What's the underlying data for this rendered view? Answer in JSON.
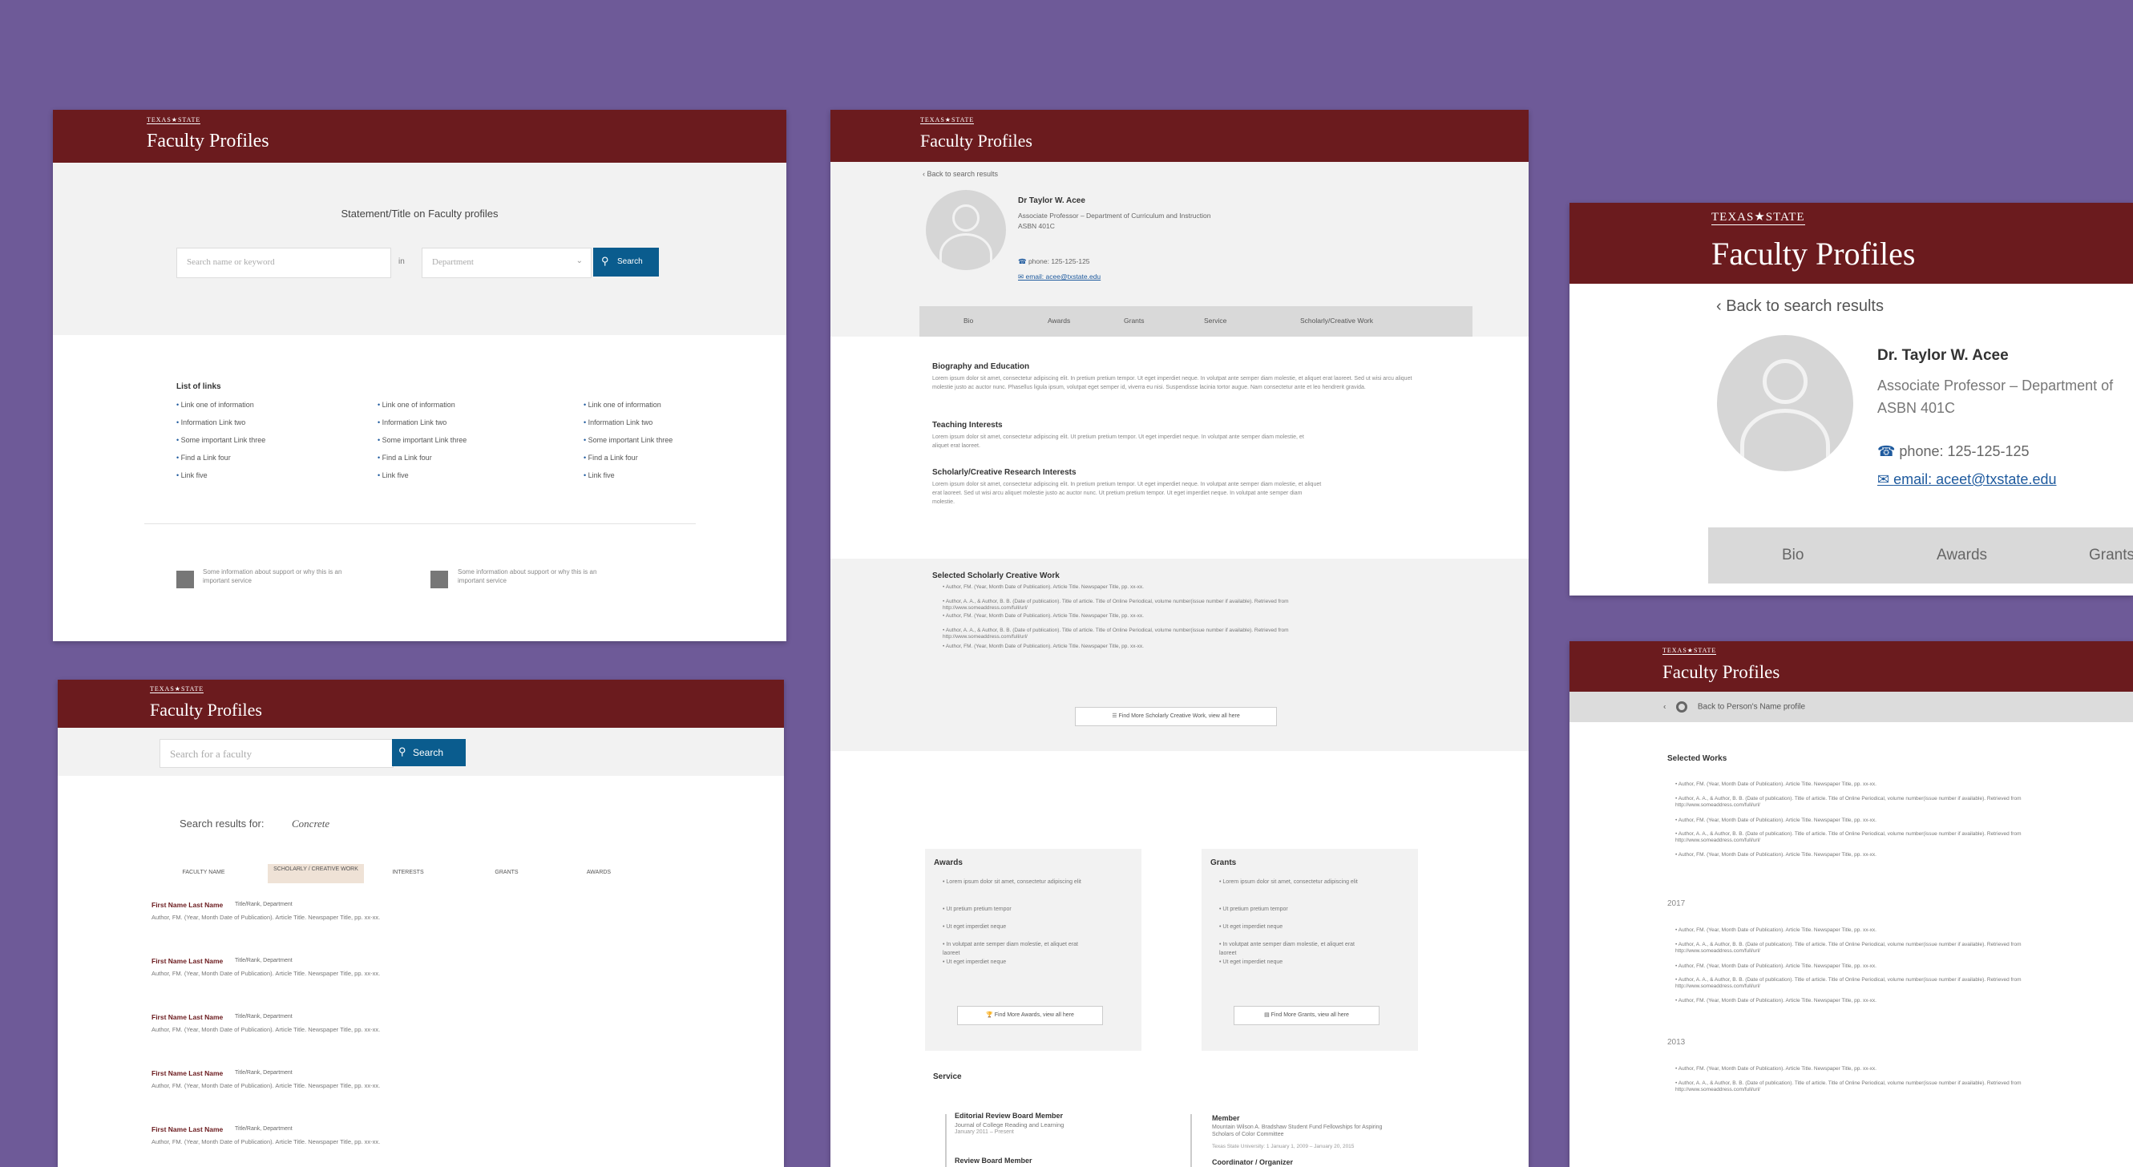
{
  "brand_text": "TEXAS★STATE",
  "app_title": "Faculty Profiles",
  "colors": {
    "header": "#6b1b1e",
    "background": "#6e5a98",
    "accent": "#0a5c8e",
    "link": "#1e5a9e"
  },
  "home": {
    "statement": "Statement/Title on Faculty profiles",
    "search_placeholder": "Search name or keyword",
    "in_label": "in",
    "dept_placeholder": "Department",
    "search_button": "Search",
    "links_title": "List of links",
    "links_col1": [
      "Link one of information",
      "Information Link two",
      "Some important Link three",
      "Find a Link four",
      "Link five"
    ],
    "links_col2": [
      "Link one of information",
      "Information Link two",
      "Some important Link three",
      "Find a Link four",
      "Link five"
    ],
    "links_col3": [
      "Link one of information",
      "Information Link two",
      "Some important Link three",
      "Find a Link four",
      "Link five"
    ],
    "support1": "Some information about support or why this is an important service",
    "support2": "Some information about support or why this is an important service"
  },
  "results": {
    "search_placeholder": "Search for a faculty",
    "search_button": "Search",
    "results_label": "Search results for:",
    "query": "Concrete",
    "tabs": [
      "FACULTY NAME",
      "SCHOLARLY / CREATIVE WORK",
      "INTERESTS",
      "GRANTS",
      "AWARDS"
    ],
    "items": [
      {
        "name": "First Name Last Name",
        "meta": "Title/Rank, Department",
        "citation": "Author, FM. (Year, Month Date of Publication). Article Title. Newspaper Title, pp. xx-xx."
      },
      {
        "name": "First Name Last Name",
        "meta": "Title/Rank, Department",
        "citation": "Author, FM. (Year, Month Date of Publication). Article Title. Newspaper Title, pp. xx-xx."
      },
      {
        "name": "First Name Last Name",
        "meta": "Title/Rank, Department",
        "citation": "Author, FM. (Year, Month Date of Publication). Article Title. Newspaper Title, pp. xx-xx."
      },
      {
        "name": "First Name Last Name",
        "meta": "Title/Rank, Department",
        "citation": "Author, FM. (Year, Month Date of Publication). Article Title. Newspaper Title, pp. xx-xx."
      },
      {
        "name": "First Name Last Name",
        "meta": "Title/Rank, Department",
        "citation": "Author, FM. (Year, Month Date of Publication). Article Title. Newspaper Title, pp. xx-xx."
      }
    ]
  },
  "profile": {
    "back": "Back to search results",
    "name": "Dr Taylor W. Acee",
    "position": "Associate Professor – Department of Curriculum and Instruction",
    "office": "ASBN 401C",
    "phone": "phone: 125-125-125",
    "email": "email: acee@txstate.edu",
    "tabs": [
      "Bio",
      "Awards",
      "Grants",
      "Service",
      "Scholarly/Creative Work"
    ],
    "bio_title": "Biography and Education",
    "bio_text": "Lorem ipsum dolor sit amet, consectetur adipiscing elit. In pretium pretium tempor. Ut eget imperdiet neque. In volutpat ante semper diam molestie, et aliquet erat laoreet. Sed ut wisi arcu aliquet molestie justo ac auctor nunc. Phasellus ligula ipsum, volutpat eget semper id, viverra eu nisi. Suspendisse lacinia tortor augue. Nam consectetur ante et leo hendrerit gravida.",
    "teach_title": "Teaching Interests",
    "teach_text": "Lorem ipsum dolor sit amet, consectetur adipiscing elit. Ut pretium pretium tempor. Ut eget imperdiet neque. In volutpat ante semper diam molestie, et aliquet erat laoreet.",
    "research_title": "Scholarly/Creative Research Interests",
    "research_text": "Lorem ipsum dolor sit amet, consectetur adipiscing elit. In pretium pretium tempor. Ut eget imperdiet neque. In volutpat ante semper diam molestie, et aliquet erat laoreet. Sed ut wisi arcu aliquet molestie justo ac auctor nunc. Ut pretium pretium tempor. Ut eget imperdiet neque. In volutpat ante semper diam molestie.",
    "selected_title": "Selected Scholarly Creative Work",
    "selected_items": [
      "Author, FM. (Year, Month Date of Publication). Article Title. Newspaper Title, pp. xx-xx.",
      "Author, A. A., & Author, B. B. (Date of publication). Title of article. Title of Online Periodical, volume number(issue number if available). Retrieved from http://www.someaddress.com/full/url/",
      "Author, FM. (Year, Month Date of Publication). Article Title. Newspaper Title, pp. xx-xx.",
      "Author, A. A., & Author, B. B. (Date of publication). Title of article. Title of Online Periodical, volume number(issue number if available). Retrieved from http://www.someaddress.com/full/url/",
      "Author, FM. (Year, Month Date of Publication). Article Title. Newspaper Title, pp. xx-xx."
    ],
    "more_work": "Find More Scholarly Creative Work, view all here",
    "awards_title": "Awards",
    "awards_items": [
      "Lorem ipsum dolor sit amet, consectetur adipiscing elit",
      "Ut pretium pretium tempor",
      "Ut eget imperdiet neque",
      "In volutpat ante semper diam molestie, et aliquet erat laoreet",
      "Ut eget imperdiet neque"
    ],
    "more_awards": "Find More Awards, view all here",
    "grants_title": "Grants",
    "grants_items": [
      "Lorem ipsum dolor sit amet, consectetur adipiscing elit",
      "Ut pretium pretium tempor",
      "Ut eget imperdiet neque",
      "In volutpat ante semper diam molestie, et aliquet erat laoreet",
      "Ut eget imperdiet neque"
    ],
    "more_grants": "Find More Grants, view all here",
    "service_title": "Service",
    "service1_title": "Editorial Review Board Member",
    "service1_sub": "Journal of College Reading and Learning",
    "service1_date": "January 2011 – Present",
    "service2_title": "Review Board Member",
    "service3_title": "Member",
    "service3_sub": "Mountain Wilson A. Bradshaw Student Fund Fellowships for Aspiring Scholars of Color Committee",
    "service3_date": "Texas State University: 1 January 1, 2009 – January 20, 2015",
    "service4_title": "Coordinator / Organizer"
  },
  "zoom": {
    "back": "Back to search results",
    "name": "Dr. Taylor W. Acee",
    "position": "Associate Professor – Department of",
    "office": "ASBN 401C",
    "phone": "phone: 125-125-125",
    "email": "email: aceet@txstate.edu",
    "tabs": [
      "Bio",
      "Awards",
      "Grants"
    ]
  },
  "works": {
    "back": "Back to Person's Name profile",
    "title": "Selected Works",
    "years": [
      "2017",
      "2013"
    ],
    "group1": [
      "Author, FM. (Year, Month Date of Publication). Article Title. Newspaper Title, pp. xx-xx.",
      "Author, A. A., & Author, B. B. (Date of publication). Title of article. Title of Online Periodical, volume number(issue number if available). Retrieved from http://www.someaddress.com/full/url/",
      "Author, FM. (Year, Month Date of Publication). Article Title. Newspaper Title, pp. xx-xx.",
      "Author, A. A., & Author, B. B. (Date of publication). Title of article. Title of Online Periodical, volume number(issue number if available). Retrieved from http://www.someaddress.com/full/url/",
      "Author, FM. (Year, Month Date of Publication). Article Title. Newspaper Title, pp. xx-xx."
    ],
    "group2": [
      "Author, FM. (Year, Month Date of Publication). Article Title. Newspaper Title, pp. xx-xx.",
      "Author, A. A., & Author, B. B. (Date of publication). Title of article. Title of Online Periodical, volume number(issue number if available). Retrieved from http://www.someaddress.com/full/url/",
      "Author, FM. (Year, Month Date of Publication). Article Title. Newspaper Title, pp. xx-xx.",
      "Author, A. A., & Author, B. B. (Date of publication). Title of article. Title of Online Periodical, volume number(issue number if available). Retrieved from http://www.someaddress.com/full/url/",
      "Author, FM. (Year, Month Date of Publication). Article Title. Newspaper Title, pp. xx-xx."
    ],
    "group3": [
      "Author, FM. (Year, Month Date of Publication). Article Title. Newspaper Title, pp. xx-xx.",
      "Author, A. A., & Author, B. B. (Date of publication). Title of article. Title of Online Periodical, volume number(issue number if available). Retrieved from http://www.someaddress.com/full/url/"
    ]
  }
}
